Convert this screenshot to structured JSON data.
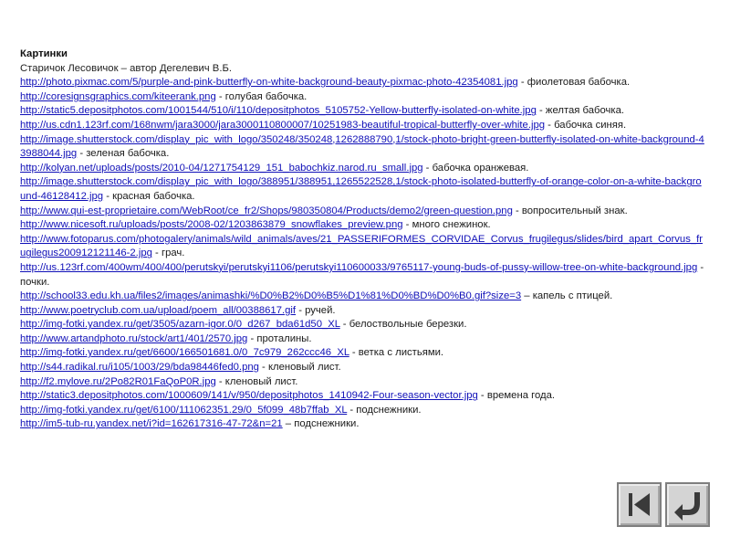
{
  "heading": "Картинки",
  "author": "Старичок Лесовичок – автор Дегелевич В.Б.",
  "links": [
    {
      "url": "http://photo.pixmac.com/5/purple-and-pink-butterfly-on-white-background-beauty-pixmac-photo-42354081.jpg",
      "desc": " - фиолетовая бабочка."
    },
    {
      "url": "http://coresignsgraphics.com/kiteerank.png",
      "desc": " - голубая бабочка."
    },
    {
      "url": "http://static5.depositphotos.com/1001544/510/i/110/depositphotos_5105752-Yellow-butterfly-isolated-on-white.jpg",
      "desc": " - желтая бабочка."
    },
    {
      "url": "http://us.cdn1.123rf.com/168nwm/jara3000/jara3000110800007/10251983-beautiful-tropical-butterfly-over-white.jpg",
      "desc": " - бабочка синяя."
    },
    {
      "url": "http://image.shutterstock.com/display_pic_with_logo/350248/350248,1262888790,1/stock-photo-bright-green-butterfly-isolated-on-white-background-43988044.jpg",
      "desc": " - зеленая бабочка."
    },
    {
      "url": "http://kolyan.net/uploads/posts/2010-04/1271754129_151_babochkiz.narod.ru_small.jpg",
      "desc": " - бабочка оранжевая."
    },
    {
      "url": "http://image.shutterstock.com/display_pic_with_logo/388951/388951,1265522528,1/stock-photo-isolated-butterfly-of-orange-color-on-a-white-background-46128412.jpg",
      "desc": " - красная бабочка."
    },
    {
      "url": "http://www.qui-est-proprietaire.com/WebRoot/ce_fr2/Shops/980350804/Products/demo2/green-question.png",
      "desc": " - вопросительный знак."
    },
    {
      "url": "http://www.nicesoft.ru/uploads/posts/2008-02/1203863879_snowflakes_preview.png",
      "desc": " - много снежинок."
    },
    {
      "url": "http://www.fotoparus.com/photogalery/animals/wild_animals/aves/21_PASSERIFORMES_CORVIDAE_Corvus_frugilegus/slides/bird_apart_Corvus_frugilegus200912121146-2.jpg",
      "desc": " - грач."
    },
    {
      "url": "http://us.123rf.com/400wm/400/400/perutskyi/perutskyi1106/perutskyi110600033/9765117-young-buds-of-pussy-willow-tree-on-white-background.jpg",
      "desc": " - почки."
    },
    {
      "url": "http://school33.edu.kh.ua/files2/images/animashki/%D0%B2%D0%B5%D1%81%D0%BD%D0%B0.gif?size=3",
      "desc": " – капель с птицей."
    },
    {
      "url": "http://www.poetryclub.com.ua/upload/poem_all/00388617.gif",
      "desc": " - ручей."
    },
    {
      "url": "http://img-fotki.yandex.ru/get/3505/azarn-igor.0/0_d267_bda61d50_XL",
      "desc": " - белоствольные березки."
    },
    {
      "url": "http://www.artandphoto.ru/stock/art1/401/2570.jpg",
      "desc": " - проталины."
    },
    {
      "url": "http://img-fotki.yandex.ru/get/6600/166501681.0/0_7c979_262ccc46_XL",
      "desc": " - ветка с листьями."
    },
    {
      "url": "http://s44.radikal.ru/i105/1003/29/bda98446fed0.png",
      "desc": " - кленовый лист."
    },
    {
      "url": "http://f2.mylove.ru/2Po82R01FaQoP0R.jpg",
      "desc": " - кленовый лист."
    },
    {
      "url": "http://static3.depositphotos.com/1000609/141/v/950/depositphotos_1410942-Four-season-vector.jpg",
      "desc": " - времена года."
    },
    {
      "url": "http://img-fotki.yandex.ru/get/6100/111062351.29/0_5f099_48b7ffab_XL",
      "desc": " - подснежники."
    },
    {
      "url": "http://im5-tub-ru.yandex.net/i?id=162617316-47-72&n=21",
      "desc": " – подснежники."
    }
  ],
  "nav": {
    "first_icon": "skip-to-first-icon",
    "back_icon": "return-icon",
    "button_face": "#d4d4d4",
    "icon_color": "#3a3a3a"
  }
}
